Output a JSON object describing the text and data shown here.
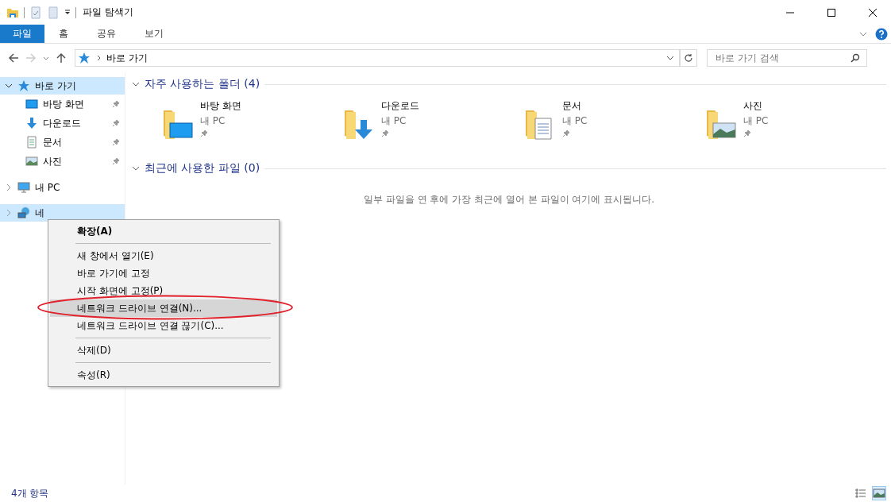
{
  "window": {
    "title": "파일 탐색기"
  },
  "ribbon_tabs": [
    {
      "label": "파일",
      "selected": true
    },
    {
      "label": "홈",
      "selected": false
    },
    {
      "label": "공유",
      "selected": false
    },
    {
      "label": "보기",
      "selected": false
    }
  ],
  "address_bar": {
    "path": "바로 가기"
  },
  "search": {
    "placeholder": "바로 가기 검색"
  },
  "sidebar": {
    "items": [
      {
        "label": "바로 가기",
        "kind": "star",
        "expanded": true,
        "selected": true,
        "children": [
          {
            "label": "바탕 화면",
            "kind": "desktop",
            "pinned": true
          },
          {
            "label": "다운로드",
            "kind": "downloads",
            "pinned": true
          },
          {
            "label": "문서",
            "kind": "documents",
            "pinned": true
          },
          {
            "label": "사진",
            "kind": "pictures",
            "pinned": true
          }
        ]
      },
      {
        "label": "내 PC",
        "kind": "pc",
        "expanded": false,
        "selected": false
      },
      {
        "label": "네",
        "kind": "network",
        "expanded": false,
        "selected": true
      }
    ]
  },
  "sections": [
    {
      "title": "자주 사용하는 폴더 (4)",
      "expanded": true,
      "folders": [
        {
          "name": "바탕 화면",
          "location": "내 PC",
          "kind": "desktop",
          "pinned": true
        },
        {
          "name": "다운로드",
          "location": "내 PC",
          "kind": "downloads",
          "pinned": true
        },
        {
          "name": "문서",
          "location": "내 PC",
          "kind": "documents",
          "pinned": true
        },
        {
          "name": "사진",
          "location": "내 PC",
          "kind": "pictures",
          "pinned": true
        }
      ]
    },
    {
      "title": "최근에 사용한 파일 (0)",
      "expanded": true,
      "empty_message": "일부 파일을 연 후에 가장 최근에 열어 본 파일이 여기에 표시됩니다."
    }
  ],
  "context_menu": {
    "items": [
      {
        "kind": "item",
        "label": "확장(A)",
        "default": true,
        "selected": false
      },
      {
        "kind": "separator"
      },
      {
        "kind": "item",
        "label": "새 창에서 열기(E)",
        "default": false,
        "selected": false
      },
      {
        "kind": "item",
        "label": "바로 가기에 고정",
        "default": false,
        "selected": false
      },
      {
        "kind": "item",
        "label": "시작 화면에 고정(P)",
        "default": false,
        "selected": false
      },
      {
        "kind": "item",
        "label": "네트워크 드라이브 연결(N)...",
        "default": false,
        "selected": true
      },
      {
        "kind": "item",
        "label": "네트워크 드라이브 연결 끊기(C)...",
        "default": false,
        "selected": false
      },
      {
        "kind": "separator"
      },
      {
        "kind": "item",
        "label": "삭제(D)",
        "default": false,
        "selected": false
      },
      {
        "kind": "separator"
      },
      {
        "kind": "item",
        "label": "속성(R)",
        "default": false,
        "selected": false
      }
    ]
  },
  "status_bar": {
    "count": "4개 항목"
  }
}
